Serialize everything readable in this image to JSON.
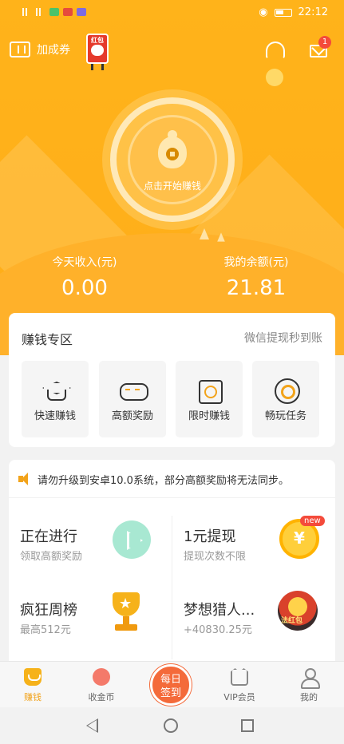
{
  "status": {
    "time": "22:12"
  },
  "topbar": {
    "coupon_label": "加成券",
    "mascot_label": "红包",
    "mail_badge": "1"
  },
  "hero": {
    "start_label": "点击开始赚钱"
  },
  "stats": {
    "today_label": "今天收入(元)",
    "today_value": "0.00",
    "balance_label": "我的余额(元)",
    "balance_value": "21.81"
  },
  "earn_zone": {
    "title": "赚钱专区",
    "subtitle": "微信提现秒到账",
    "features": [
      {
        "label": "快速赚钱",
        "icon": "graduation-cap-icon"
      },
      {
        "label": "高额奖励",
        "icon": "gamepad-icon"
      },
      {
        "label": "限时赚钱",
        "icon": "camera-icon"
      },
      {
        "label": "畅玩任务",
        "icon": "target-icon"
      }
    ]
  },
  "notice": {
    "text": "请勿升级到安卓10.0系统，部分高额奖励将无法同步。"
  },
  "items": [
    {
      "title": "正在进行",
      "sub": "领取高额奖励",
      "icon": "play-icon"
    },
    {
      "title": "1元提现",
      "sub": "提现次数不限",
      "icon": "coin-icon",
      "badge": "new"
    },
    {
      "title": "疯狂周榜",
      "sub": "最高512元",
      "icon": "trophy-icon"
    },
    {
      "title": "梦想猎人...",
      "sub": "+40830.25元",
      "icon": "game-icon",
      "icon_text": "法红包"
    }
  ],
  "tabs": [
    {
      "label": "赚钱"
    },
    {
      "label": "收金币"
    },
    {
      "label": "VIP会员"
    },
    {
      "label": "我的"
    }
  ],
  "signin": {
    "line1": "每日",
    "line2": "签到"
  },
  "colors": {
    "accent": "#ffb31a",
    "signin": "#f46a3a"
  }
}
